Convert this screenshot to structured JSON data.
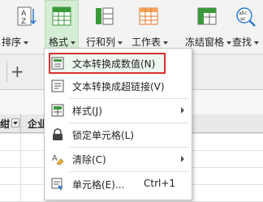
{
  "ribbon": {
    "buttons": [
      {
        "label": "排序",
        "icon": "sort-icon"
      },
      {
        "label": "格式",
        "icon": "format-icon"
      },
      {
        "label": "行和列",
        "icon": "rows-columns-icon"
      },
      {
        "label": "工作表",
        "icon": "worksheet-icon"
      },
      {
        "label": "冻结窗格",
        "icon": "freeze-panes-icon"
      },
      {
        "label": "查找",
        "icon": "find-icon"
      }
    ],
    "sort_icon_text": "A\nZ",
    "find_icon_text": "abc\nac"
  },
  "tabs": {
    "add_label": "+"
  },
  "sheet": {
    "header_a": "绀",
    "header_b": "企业"
  },
  "menu": {
    "items": [
      {
        "label": "文本转换成数值(N)",
        "icon": "text-to-number-icon"
      },
      {
        "label": "文本转换成超链接(V)",
        "icon": "text-to-hyperlink-icon"
      },
      {
        "label": "样式(J)",
        "icon": "style-icon",
        "submenu": true
      },
      {
        "label": "锁定单元格(L)",
        "icon": "lock-icon"
      },
      {
        "label": "清除(C)",
        "icon": "clear-icon",
        "submenu": true
      },
      {
        "label": "单元格(E)...",
        "icon": "cell-format-icon",
        "shortcut": "Ctrl+1"
      }
    ]
  },
  "colors": {
    "accent_green": "#3a9a3a",
    "highlight_border": "#d9312e",
    "selected_bg": "#d5ecd5"
  }
}
